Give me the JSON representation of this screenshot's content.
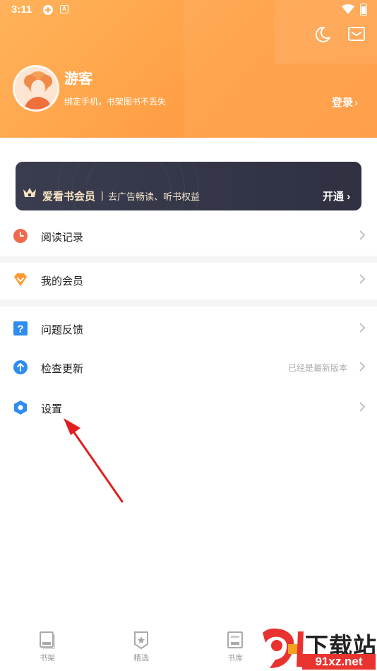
{
  "status_bar": {
    "time": "3:11",
    "badge_letter": "A"
  },
  "header": {
    "username": "游客",
    "subtitle": "绑定手机，书架图书不丢失",
    "login_label": "登录",
    "icons": [
      "moon-icon",
      "mail-icon"
    ]
  },
  "vip_banner": {
    "title": "爱看书会员",
    "separator": "|",
    "description": "去广告畅读、听书权益",
    "action_label": "开通"
  },
  "menu": [
    {
      "label": "阅读记录",
      "icon": "clock-icon",
      "color": "#f06a4c",
      "value": ""
    },
    {
      "label": "我的会员",
      "icon": "diamond-icon",
      "color": "#ff9b2f",
      "value": ""
    },
    {
      "label": "问题反馈",
      "icon": "question-icon",
      "color": "#2f8cf0",
      "value": ""
    },
    {
      "label": "检查更新",
      "icon": "upload-icon",
      "color": "#2f8cf0",
      "value": "已经是最新版本"
    },
    {
      "label": "设置",
      "icon": "settings-hexagon-icon",
      "color": "#2f8cf0",
      "value": ""
    }
  ],
  "tabs": [
    {
      "label": "书架",
      "icon": "bookshelf-icon"
    },
    {
      "label": "精选",
      "icon": "featured-icon"
    },
    {
      "label": "书库",
      "icon": "library-icon"
    }
  ],
  "watermark": {
    "brand": "下载站",
    "url": "91xz.net"
  },
  "colors": {
    "header_orange": "#ff9f45",
    "vip_dark": "#343647",
    "arrow_red": "#e02020"
  }
}
